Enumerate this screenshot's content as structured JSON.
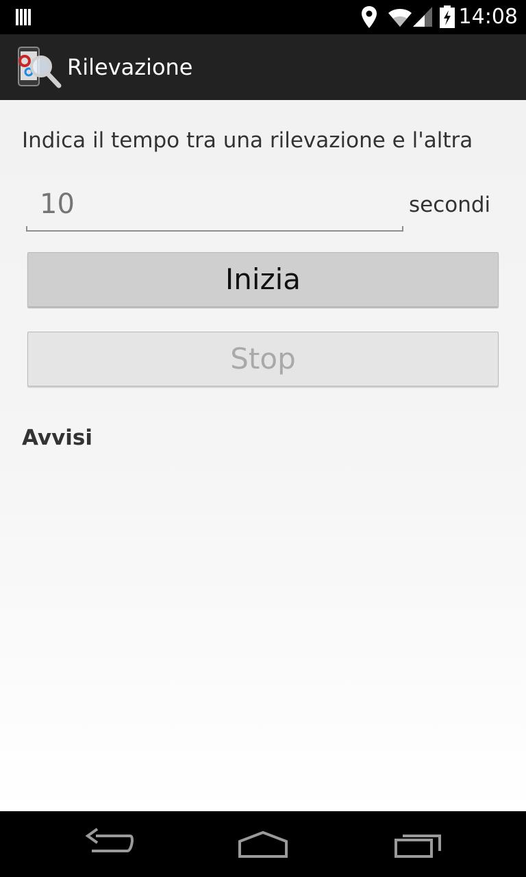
{
  "status_bar": {
    "time": "14:08",
    "icons": [
      "notification-icon",
      "location-icon",
      "wifi-icon",
      "cell-signal-icon",
      "battery-charging-icon"
    ]
  },
  "action_bar": {
    "app_icon": "app-logo-icon",
    "title": "Rilevazione"
  },
  "form": {
    "instruction": "Indica il tempo tra una rilevazione e l'altra",
    "interval_placeholder": "10",
    "unit": "secondi",
    "start_label": "Inizia",
    "stop_label": "Stop"
  },
  "alerts": {
    "heading": "Avvisi"
  },
  "nav_bar": {
    "icons": [
      "back-icon",
      "home-icon",
      "recents-icon"
    ]
  },
  "colors": {
    "action_bar_bg": "#222222",
    "content_bg": "#f2f2f2",
    "text": "#333333",
    "disabled_text": "#a9a9a9"
  }
}
